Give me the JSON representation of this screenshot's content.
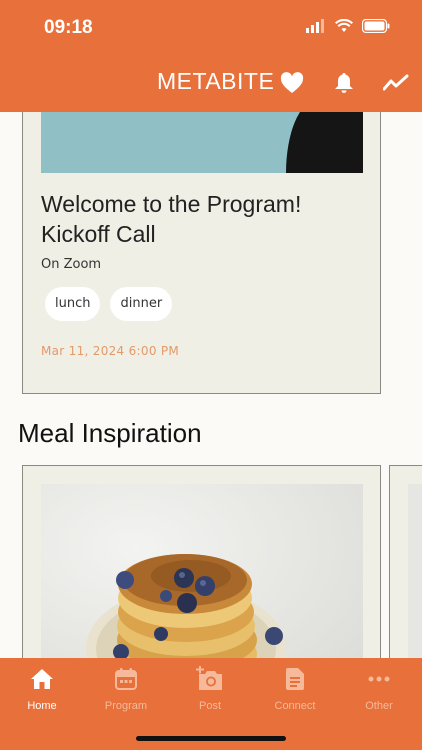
{
  "status_bar": {
    "time": "09:18"
  },
  "header": {
    "title": "METABITE",
    "icons": [
      "heart-icon",
      "bell-icon",
      "trend-icon"
    ]
  },
  "event": {
    "title": "Welcome to the Program! Kickoff Call",
    "location": "On Zoom",
    "tags": [
      "lunch",
      "dinner"
    ],
    "date": "Mar 11, 2024 6:00 PM"
  },
  "meal_section": {
    "title": "Meal Inspiration"
  },
  "bottom_nav": {
    "items": [
      {
        "label": "Home",
        "icon": "home-icon",
        "active": true
      },
      {
        "label": "Program",
        "icon": "calendar-icon",
        "active": false
      },
      {
        "label": "Post",
        "icon": "camera-add-icon",
        "active": false
      },
      {
        "label": "Connect",
        "icon": "document-icon",
        "active": false
      },
      {
        "label": "Other",
        "icon": "more-icon",
        "active": false
      }
    ]
  },
  "colors": {
    "brand": "#e8703a",
    "card": "#efefe6",
    "date": "#e39a6a"
  }
}
